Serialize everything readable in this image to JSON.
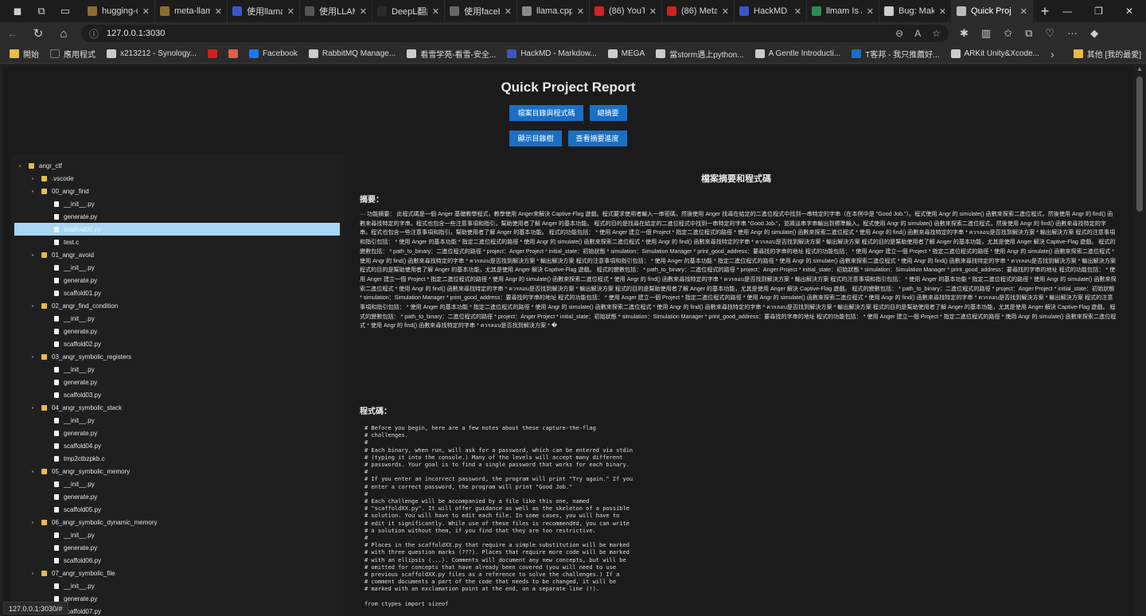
{
  "browser": {
    "tabs": [
      {
        "title": "hugging-q",
        "color": "#8a6d2f"
      },
      {
        "title": "meta-llama",
        "color": "#8a6d2f"
      },
      {
        "title": "使用llama",
        "color": "#3b55c8"
      },
      {
        "title": "使用LLAMA",
        "color": "#555555"
      },
      {
        "title": "DeepL翻譯",
        "color": "#2a2a2a"
      },
      {
        "title": "使用facebo",
        "color": "#666666"
      },
      {
        "title": "llama.cpp",
        "color": "#8a8a8a"
      },
      {
        "title": "(86) YouTu",
        "color": "#d32020"
      },
      {
        "title": "(86) MetaA",
        "color": "#d32020"
      },
      {
        "title": "HackMD - ",
        "color": "#3b55c8"
      },
      {
        "title": "llmam Is /u",
        "color": "#2e8b57"
      },
      {
        "title": "Bug: Make",
        "color": "#cccccc"
      },
      {
        "title": "Quick Proj",
        "color": "#bbbbbb"
      }
    ],
    "url": "127.0.0.1:3030",
    "bookmarks": [
      {
        "label": "開始",
        "type": "folder"
      },
      {
        "label": "應用程式",
        "type": "grid"
      },
      {
        "label": "x213212 - Synology...",
        "type": "link",
        "color": "#cccccc"
      },
      {
        "label": "",
        "type": "link",
        "color": "#d32020"
      },
      {
        "label": "",
        "type": "link",
        "color": "#e35d4a"
      },
      {
        "label": "Facebook",
        "type": "link",
        "color": "#1877f2"
      },
      {
        "label": "RabbitMQ Manage...",
        "type": "link",
        "color": "#cccccc"
      },
      {
        "label": "看雪学苑-看雪-安全...",
        "type": "link",
        "color": "#cccccc"
      },
      {
        "label": "HackMD - Markdow...",
        "type": "link",
        "color": "#3b55c8"
      },
      {
        "label": "MEGA",
        "type": "link",
        "color": "#cccccc"
      },
      {
        "label": "當storm遇上python...",
        "type": "link",
        "color": "#cccccc"
      },
      {
        "label": "A Gentle Introducti...",
        "type": "link",
        "color": "#cccccc"
      },
      {
        "label": "T客邦 - 我只推薦好...",
        "type": "link",
        "color": "#1a6fc4"
      },
      {
        "label": "ARKit Unity&Xcode...",
        "type": "link",
        "color": "#cccccc"
      }
    ],
    "other_bookmarks": "其他 [我的最愛]",
    "status_url": "127.0.0.1:3030/#"
  },
  "page": {
    "title": "Quick Project Report",
    "buttons_row1": [
      "檔案目錄與程式碼",
      "總摘要"
    ],
    "buttons_row2": [
      "顯示目錄樹",
      "查看摘要進度"
    ],
    "section_title": "檔案摘要和程式碼",
    "summary_label": "摘要：",
    "code_label": "程式碼：",
    "summary_text": "··· 功能摘要： 此程式碼是一個 Anger 基礎教學程式，教學使用 Anger來解決 Captive-Flag 遊戲。程式要求使用者輸入一串密碼，然後使用 Anger 找尋在給定的二進位程式中找到一串特定的字串（在本例中是 \"Good Job.\"）。程式使用 Angr 的 simulate() 函數來探索二進位程式，然後使用 Angr 的 find() 函數來尋找特定的字串。程式也包含一些注意事項和指引，幫助使用者了解 Anger 的基本功能。 程式的目的是找尋在給定的二進位程式中找到一串特定的字串 \"Good Job.\"，並將這串字串輸出到標準輸入。程式使用 Angr 的 simulate() 函數來探索二進位程式，然後使用 Angr 的 find() 函數來尋找特定的字串。程式也包含一些注意事項和指引，幫助使用者了解 Anger 的基本功能。 程式的功能包括： * 使用 Anger 建立一個 Project * 指定二進位程式的路徑 * 使用 Angr 的 simulate() 函數來探索二進位程式 * 使用 Angr 的 find() 函數來尋找特定的字串 * ควรลอบ是否找到解決方案 * 輸出解決方案 程式的注意事項和指引包括： * 使用 Anger 的基本功能 * 指定二進位程式的路徑 * 使用 Angr 的 simulate() 函數來探索二進位程式 * 使用 Angr 的 find() 函數來尋找特定的字串 * ควรลอบ是否找到解決方案 * 輸出解決方案 程式的目的是幫助使用者了解 Anger 的基本功能，尤其是使用 Anger 解決 Captive-Flag 遊戲。 程式的變數包括： * path_to_binary：二進位程式的路徑 * project：Anger Project * initial_state：初始狀態 * simulation：Simulation Manager * print_good_address：要尋找的字串的地址 程式的功能包括： * 使用 Anger 建立一個 Project * 指定二進位程式的路徑 * 使用 Angr 的 simulate() 函數來探索二進位程式 * 使用 Angr 的 find() 函數來尋找特定的字串 * ควรลอบ是否找到解決方案 * 輸出解決方案 程式的注意事項和指引包括： * 使用 Anger 的基本功能 * 指定二進位程式的路徑 * 使用 Angr 的 simulate() 函數來探索二進位程式 * 使用 Angr 的 find() 函數來尋找特定的字串 * ควรลอบ是否找到解決方案 * 輸出解決方案 程式的目的是幫助使用者了解 Anger 的基本功能，尤其是使用 Anger 解決 Captive-Flag 遊戲。 程式的變數包括： * path_to_binary：二進位程式的路徑 * project：Anger Project * initial_state：初始狀態 * simulation：Simulation Manager * print_good_address：要尋找的字串的地址 程式的功能包括： * 使用 Anger 建立一個 Project * 指定二進位程式的路徑 * 使用 Angr 的 simulate() 函數來探索二進位程式 * 使用 Angr 的 find() 函數來尋找特定的字串 * ควรลอบ是否找到解決方案 * 輸出解決方案 程式的注意事項和指引包括： * 使用 Anger 的基本功能 * 指定二進位程式的路徑 * 使用 Angr 的 simulate() 函數來探索二進位程式 * 使用 Angr 的 find() 函數來尋找特定的字串 * ควรลอบ是否找到解決方案 * 輸出解決方案 程式的目的是幫助使用者了解 Anger 的基本功能，尤其是使用 Anger 解決 Captive-Flag 遊戲。 程式的變數包括： * path_to_binary：二進位程式的路徑 * project：Anger Project * initial_state：初始狀態 * simulation：Simulation Manager * print_good_address：要尋找的字串的地址 程式的功能包括： * 使用 Anger 建立一個 Project * 指定二進位程式的路徑 * 使用 Angr 的 simulate() 函數來探索二進位程式 * 使用 Angr 的 find() 函數來尋找特定的字串 * ควรลอบ是否找到解決方案 * 輸出解決方案 程式的注意事項和指引包括： * 使用 Anger 的基本功能 * 指定二進位程式的路徑 * 使用 Angr 的 simulate() 函數來探索二進位程式 * 使用 Angr 的 find() 函數來尋找特定的字串 * ควรลอบ是否找到解決方案 * 輸出解決方案 程式的目的是幫助使用者了解 Anger 的基本功能，尤其是使用 Anger 解決 Captive-Flag 遊戲。 程式的變數包括： * path_to_binary：二進位程式的路徑 * project：Anger Project * initial_state：初始狀態 * simulation：Simulation Manager * print_good_address：要尋找的字串的地址 程式的功能包括： * 使用 Anger 建立一個 Project * 指定二進位程式的路徑 * 使用 Angr 的 simulate() 函數來探索二進位程式 * 使用 Angr 的 find() 函數來尋找特定的字串 * ควรลอบ是否找到解決方案 * �",
    "code_text": "# Before you begin, here are a few notes about these capture-the-flag\n# challenges.\n#\n# Each binary, when run, will ask for a password, which can be entered via stdin\n# (typing it into the console.) Many of the levels will accept many different\n# passwords. Your goal is to find a single password that works for each binary.\n#\n# If you enter an incorrect password, the program will print \"Try again.\" If you\n# enter a correct password, the program will print \"Good Job.\"\n#\n# Each challenge will be accompanied by a file like this one, named\n# \"scaffoldXX.py\". It will offer guidance as well as the skeleton of a possible\n# solution. You will have to edit each file. In some cases, you will have to\n# edit it significantly. While use of these files is recommended, you can write\n# a solution without them, if you find that they are too restrictive.\n#\n# Places in the scaffoldXX.py that require a simple substitution will be marked\n# with three question marks (???). Places that require more code will be marked\n# with an ellipsis (...). Comments will document any new concepts, but will be\n# omitted for concepts that have already been covered (you will need to use\n# previous scaffoldXX.py files as a reference to solve the challenges.) If a\n# comment documents a part of the code that needs to be changed, it will be\n# marked with an exclamation point at the end, on a separate line (!).\n\nfrom ctypes import sizeof"
  },
  "tree": [
    {
      "label": "angr_ctf",
      "type": "folder",
      "depth": 0
    },
    {
      "label": ".vscode",
      "type": "folder",
      "depth": 1
    },
    {
      "label": "00_angr_find",
      "type": "folder",
      "depth": 1
    },
    {
      "label": "__init__.py",
      "type": "file",
      "depth": 2
    },
    {
      "label": "generate.py",
      "type": "file",
      "depth": 2
    },
    {
      "label": "scaffold00.py",
      "type": "file",
      "depth": 2,
      "selected": true
    },
    {
      "label": "test.c",
      "type": "file",
      "depth": 2
    },
    {
      "label": "01_angr_avoid",
      "type": "folder",
      "depth": 1
    },
    {
      "label": "__init__.py",
      "type": "file",
      "depth": 2
    },
    {
      "label": "generate.py",
      "type": "file",
      "depth": 2
    },
    {
      "label": "scaffold01.py",
      "type": "file",
      "depth": 2
    },
    {
      "label": "02_angr_find_condition",
      "type": "folder",
      "depth": 1
    },
    {
      "label": "__init__.py",
      "type": "file",
      "depth": 2
    },
    {
      "label": "generate.py",
      "type": "file",
      "depth": 2
    },
    {
      "label": "scaffold02.py",
      "type": "file",
      "depth": 2
    },
    {
      "label": "03_angr_symbolic_registers",
      "type": "folder",
      "depth": 1
    },
    {
      "label": "__init__.py",
      "type": "file",
      "depth": 2
    },
    {
      "label": "generate.py",
      "type": "file",
      "depth": 2
    },
    {
      "label": "scaffold03.py",
      "type": "file",
      "depth": 2
    },
    {
      "label": "04_angr_symbolic_stack",
      "type": "folder",
      "depth": 1
    },
    {
      "label": "__init__.py",
      "type": "file",
      "depth": 2
    },
    {
      "label": "generate.py",
      "type": "file",
      "depth": 2
    },
    {
      "label": "scaffold04.py",
      "type": "file",
      "depth": 2
    },
    {
      "label": "tmp2ctbzpkb.c",
      "type": "file",
      "depth": 2
    },
    {
      "label": "05_angr_symbolic_memory",
      "type": "folder",
      "depth": 1
    },
    {
      "label": "__init__.py",
      "type": "file",
      "depth": 2
    },
    {
      "label": "generate.py",
      "type": "file",
      "depth": 2
    },
    {
      "label": "scaffold05.py",
      "type": "file",
      "depth": 2
    },
    {
      "label": "06_angr_symbolic_dynamic_memory",
      "type": "folder",
      "depth": 1
    },
    {
      "label": "__init__.py",
      "type": "file",
      "depth": 2
    },
    {
      "label": "generate.py",
      "type": "file",
      "depth": 2
    },
    {
      "label": "scaffold06.py",
      "type": "file",
      "depth": 2
    },
    {
      "label": "07_angr_symbolic_file",
      "type": "folder",
      "depth": 1
    },
    {
      "label": "__init__.py",
      "type": "file",
      "depth": 2
    },
    {
      "label": "generate.py",
      "type": "file",
      "depth": 2
    },
    {
      "label": "scaffold07.py",
      "type": "file",
      "depth": 2
    }
  ]
}
